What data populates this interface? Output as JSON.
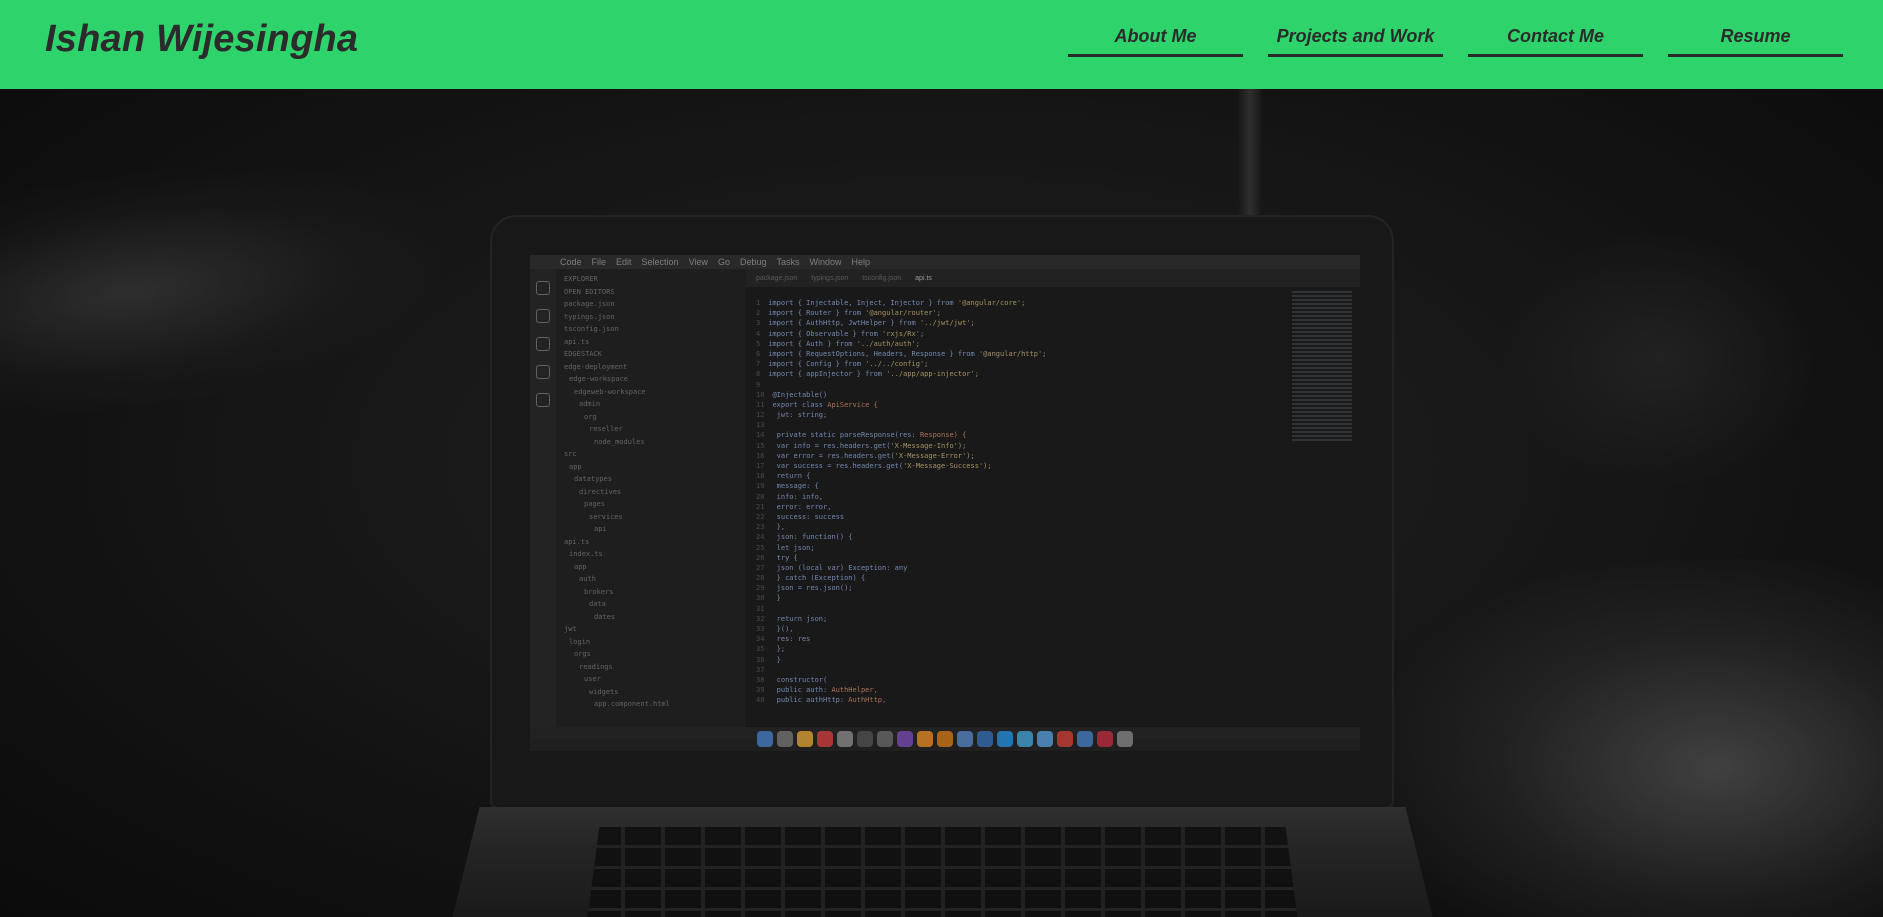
{
  "site": {
    "title": "Ishan Wijesingha"
  },
  "nav": {
    "items": [
      {
        "label": "About Me"
      },
      {
        "label": "Projects and Work"
      },
      {
        "label": "Contact Me"
      },
      {
        "label": "Resume"
      }
    ]
  },
  "colors": {
    "header_bg": "#2ed46b",
    "text_dark": "#2b2b2b"
  },
  "hero": {
    "image_description_icon": "laptop-code-photo"
  }
}
